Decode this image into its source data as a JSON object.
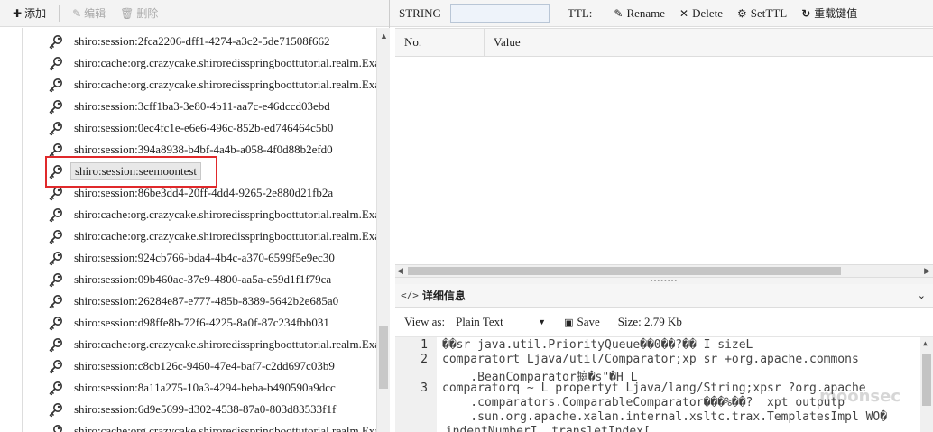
{
  "toolbar": {
    "add_label": "添加",
    "edit_label": "编辑",
    "delete_label": "删除"
  },
  "tree": {
    "items": [
      {
        "label": "shiro:session:2fca2206-dff1-4274-a3c2-5de71508f662"
      },
      {
        "label": "shiro:cache:org.crazycake.shiroredisspringboottutorial.realm.Exa"
      },
      {
        "label": "shiro:cache:org.crazycake.shiroredisspringboottutorial.realm.Exa"
      },
      {
        "label": "shiro:session:3cff1ba3-3e80-4b11-aa7c-e46dccd03ebd"
      },
      {
        "label": "shiro:session:0ec4fc1e-e6e6-496c-852b-ed746464c5b0"
      },
      {
        "label": "shiro:session:394a8938-b4bf-4a4b-a058-4f0d88b2efd0"
      },
      {
        "label": "shiro:session:seemoontest"
      },
      {
        "label": "shiro:session:86be3dd4-20ff-4dd4-9265-2e880d21fb2a"
      },
      {
        "label": "shiro:cache:org.crazycake.shiroredisspringboottutorial.realm.Exa"
      },
      {
        "label": "shiro:cache:org.crazycake.shiroredisspringboottutorial.realm.Exa"
      },
      {
        "label": "shiro:session:924cb766-bda4-4b4c-a370-6599f5e9ec30"
      },
      {
        "label": "shiro:session:09b460ac-37e9-4800-aa5a-e59d1f1f79ca"
      },
      {
        "label": "shiro:session:26284e87-e777-485b-8389-5642b2e685a0"
      },
      {
        "label": "shiro:session:d98ffe8b-72f6-4225-8a0f-87c234fbb031"
      },
      {
        "label": "shiro:cache:org.crazycake.shiroredisspringboottutorial.realm.Exa"
      },
      {
        "label": "shiro:session:c8cb126c-9460-47e4-baf7-c2dd697c03b9"
      },
      {
        "label": "shiro:session:8a11a275-10a3-4294-beba-b490590a9dcc"
      },
      {
        "label": "shiro:session:6d9e5699-d302-4538-87a0-803d83533f1f"
      },
      {
        "label": "shiro:cache:org.crazycake.shiroredisspringboottutorial.realm.Exa"
      }
    ],
    "selected_index": 6
  },
  "key_panel": {
    "type_label": "STRING",
    "key_input_value": "",
    "ttl_label": "TTL:",
    "rename_label": "Rename",
    "delete_label": "Delete",
    "setttl_label": "SetTTL",
    "reload_label": "重载键值"
  },
  "table": {
    "col_no": "No.",
    "col_value": "Value"
  },
  "detail": {
    "title": "详细信息",
    "view_as_label": "View as:",
    "view_as_value": "Plain Text",
    "save_label": "Save",
    "size_label": "Size: 2.79 Kb"
  },
  "editor": {
    "line_numbers": [
      "1",
      "2",
      "",
      "3",
      "",
      ""
    ],
    "lines": [
      {
        "text": "��sr java.util.PriorityQueue��0��?�� I sizeL"
      },
      {
        "text": "comparatort Ljava/util/Comparator;xp sr +org.apache.commons"
      },
      {
        "text": "    .BeanComparator㨩�s\"�H L"
      },
      {
        "text": "comparatorq ~ L propertyt Ljava/lang/String;xpsr ?org.apache"
      },
      {
        "text": "    .comparators.ComparableComparator���%��?  xpt outputp"
      },
      {
        "text": "    .sun.org.apache.xalan.internal.xsltc.trax.TemplatesImpl WO�"
      }
    ],
    "partial_line": ".indentNumberI .transletIndex["
  },
  "watermark": "moonsec",
  "colors": {
    "highlight_box": "#e0292b",
    "binary_marker": "#d8141c"
  }
}
